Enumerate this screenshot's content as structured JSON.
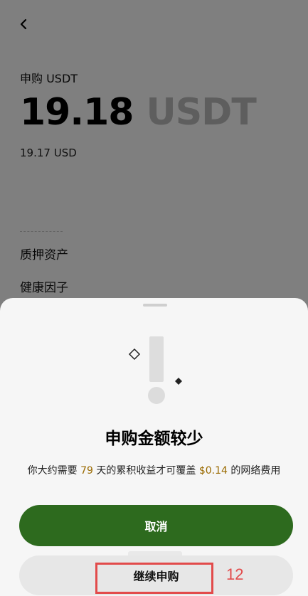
{
  "page": {
    "subtitle": "申购 USDT",
    "amount": "19.18",
    "unit": "USDT",
    "fiat": "19.17 USD",
    "rows": [
      "质押资产",
      "健康因子"
    ]
  },
  "sheet": {
    "title": "申购金额较少",
    "desc_prefix": "你大约需要 ",
    "days": "79",
    "desc_mid": " 天的累积收益才可覆盖 ",
    "fee": "$0.14",
    "desc_suffix": " 的网络费用",
    "cancel_label": "取消",
    "continue_label": "继续申购"
  },
  "annotation": {
    "number": "12"
  },
  "colors": {
    "primary": "#2d6a1e",
    "highlight_text": "#9a6a00",
    "annotation": "#e24b4b"
  }
}
